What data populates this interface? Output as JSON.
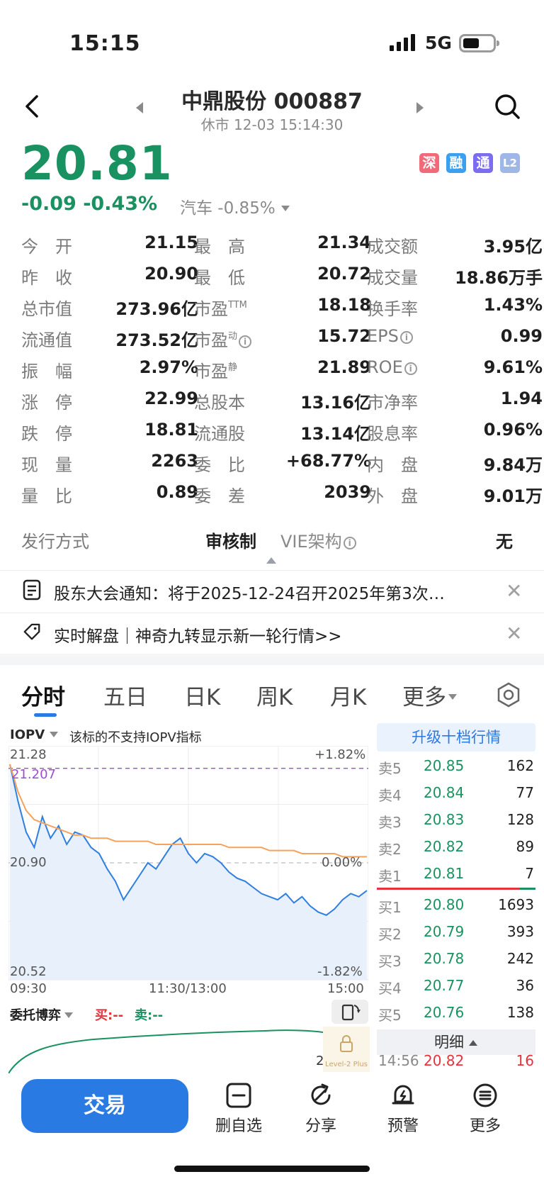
{
  "status_bar": {
    "time": "15:15",
    "network": "5G"
  },
  "header": {
    "title": "中鼎股份 000887",
    "subtitle": "休市 12-03 15:14:30"
  },
  "quote": {
    "price": "20.81",
    "change": "-0.09  -0.43%",
    "sector": "汽车 -0.85%",
    "badges": [
      "深",
      "融",
      "通",
      "L2"
    ],
    "badge_colors": [
      "#f06a7a",
      "#3aa0f0",
      "#7b6cf0",
      "#9fb7e6"
    ]
  },
  "stats": [
    {
      "l1": "今　开",
      "v1": "21.15",
      "c1": "red",
      "l2": "最　高",
      "v2": "21.34",
      "c2": "red",
      "l3": "成交额",
      "v3": "3.95亿",
      "c3": ""
    },
    {
      "l1": "昨　收",
      "v1": "20.90",
      "c1": "",
      "l2": "最　低",
      "v2": "20.72",
      "c2": "green",
      "l3": "成交量",
      "v3": "18.86万手",
      "c3": ""
    },
    {
      "l1": "总市值",
      "v1": "273.96亿",
      "c1": "",
      "l2": "市盈",
      "sup2": "TTM",
      "v2": "18.18",
      "c2": "",
      "l3": "换手率",
      "v3": "1.43%",
      "c3": ""
    },
    {
      "l1": "流通值",
      "v1": "273.52亿",
      "c1": "",
      "l2": "市盈",
      "sup2": "动",
      "info2": true,
      "v2": "15.72",
      "c2": "",
      "l3": "EPS",
      "info3": true,
      "v3": "0.99",
      "c3": ""
    },
    {
      "l1": "振　幅",
      "v1": "2.97%",
      "c1": "",
      "l2": "市盈",
      "sup2": "静",
      "v2": "21.89",
      "c2": "",
      "l3": "ROE",
      "info3": true,
      "v3": "9.61%",
      "c3": ""
    },
    {
      "l1": "涨　停",
      "v1": "22.99",
      "c1": "red",
      "l2": "总股本",
      "v2": "13.16亿",
      "c2": "",
      "l3": "市净率",
      "v3": "1.94",
      "c3": ""
    },
    {
      "l1": "跌　停",
      "v1": "18.81",
      "c1": "green",
      "l2": "流通股",
      "v2": "13.14亿",
      "c2": "",
      "l3": "股息率",
      "v3": "0.96%",
      "c3": ""
    },
    {
      "l1": "现　量",
      "v1": "2263",
      "c1": "",
      "l2": "委　比",
      "v2": "+68.77%",
      "c2": "red",
      "l3": "内　盘",
      "v3": "9.84万",
      "c3": "green"
    },
    {
      "l1": "量　比",
      "v1": "0.89",
      "c1": "",
      "l2": "委　差",
      "v2": "2039",
      "c2": "red",
      "l3": "外　盘",
      "v3": "9.01万",
      "c3": "red"
    }
  ],
  "issue": {
    "label": "发行方式",
    "value": "审核制",
    "vie_label": "VIE架构",
    "vie_value": "无"
  },
  "notices": [
    "股东大会通知：将于2025-12-24召开2025年第3次…",
    "实时解盘｜神奇九转显示新一轮行情>>"
  ],
  "tabs": [
    "分时",
    "五日",
    "日K",
    "周K",
    "月K",
    "更多"
  ],
  "iopv": {
    "label": "IOPV",
    "note": "该标的不支持IOPV指标"
  },
  "chart_data": {
    "type": "line",
    "x_labels": [
      "09:30",
      "11:30/13:00",
      "15:00"
    ],
    "ylim": [
      20.52,
      21.28
    ],
    "y_left_labels": [
      "21.28",
      "20.90",
      "20.52"
    ],
    "y_right_labels": [
      "+1.82%",
      "0.00%",
      "-1.82%"
    ],
    "open_marker": "21.207",
    "series": [
      {
        "values": [
          21.22,
          21.1,
          21.0,
          20.95,
          21.05,
          20.98,
          21.02,
          20.96,
          21.0,
          20.99,
          20.95,
          20.93,
          20.88,
          20.84,
          20.78,
          20.82,
          20.86,
          20.9,
          20.88,
          20.92,
          20.96,
          20.98,
          20.93,
          20.9,
          20.93,
          20.92,
          20.9,
          20.87,
          20.85,
          20.84,
          20.82,
          20.8,
          20.79,
          20.78,
          20.8,
          20.77,
          20.79,
          20.76,
          20.74,
          20.73,
          20.75,
          20.78,
          20.8,
          20.79,
          20.81
        ]
      },
      {
        "values": [
          21.22,
          21.13,
          21.07,
          21.04,
          21.03,
          21.02,
          21.01,
          21.0,
          20.99,
          20.99,
          20.98,
          20.98,
          20.98,
          20.97,
          20.97,
          20.97,
          20.97,
          20.97,
          20.96,
          20.96,
          20.96,
          20.96,
          20.96,
          20.96,
          20.96,
          20.96,
          20.96,
          20.95,
          20.95,
          20.95,
          20.95,
          20.95,
          20.94,
          20.94,
          20.94,
          20.94,
          20.93,
          20.93,
          20.93,
          20.93,
          20.93,
          20.92,
          20.92,
          20.92,
          20.92
        ]
      }
    ],
    "colors": {
      "price": "#2f7fe0",
      "avg": "#f5a25d",
      "open": "#9b4fd0"
    }
  },
  "orderbook": {
    "upgrade": "升级十档行情",
    "asks": [
      {
        "label": "卖5",
        "price": "20.85",
        "vol": "162"
      },
      {
        "label": "卖4",
        "price": "20.84",
        "vol": "77"
      },
      {
        "label": "卖3",
        "price": "20.83",
        "vol": "128"
      },
      {
        "label": "卖2",
        "price": "20.82",
        "vol": "89"
      },
      {
        "label": "卖1",
        "price": "20.81",
        "vol": "7"
      }
    ],
    "bids": [
      {
        "label": "买1",
        "price": "20.80",
        "vol": "1693"
      },
      {
        "label": "买2",
        "price": "20.79",
        "vol": "393"
      },
      {
        "label": "买3",
        "price": "20.78",
        "vol": "242"
      },
      {
        "label": "买4",
        "price": "20.77",
        "vol": "36"
      },
      {
        "label": "买5",
        "price": "20.76",
        "vol": "138"
      }
    ],
    "detail": "明细",
    "tick": {
      "time": "14:56",
      "price": "20.82",
      "vol": "16"
    }
  },
  "weituo": {
    "label": "委托博弈",
    "buy": "买:--",
    "sell": "卖:--",
    "axis_tail": "2",
    "lock_text": "Level-2 Plus"
  },
  "toolbar": {
    "trade": "交易",
    "items": [
      "删自选",
      "分享",
      "预警",
      "更多"
    ]
  }
}
